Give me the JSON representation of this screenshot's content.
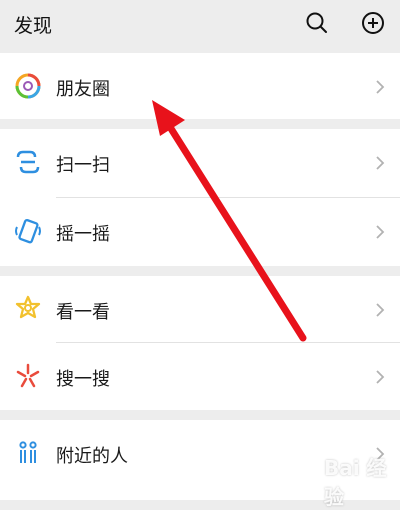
{
  "header": {
    "title": "发现",
    "icons": [
      "search-icon",
      "add-circle-icon"
    ]
  },
  "menu": {
    "items": [
      {
        "label": "朋友圈",
        "icon": "moments-icon"
      },
      {
        "label": "扫一扫",
        "icon": "scan-icon"
      },
      {
        "label": "摇一摇",
        "icon": "shake-icon"
      },
      {
        "label": "看一看",
        "icon": "top-stories-icon"
      },
      {
        "label": "搜一搜",
        "icon": "search-spark-icon"
      },
      {
        "label": "附近的人",
        "icon": "nearby-people-icon"
      }
    ]
  },
  "watermark": {
    "text": "Bai 经验"
  },
  "colors": {
    "background": "#ededed",
    "row": "#ffffff",
    "arrow": "#e8121b",
    "divider": "#e2e2e2"
  }
}
